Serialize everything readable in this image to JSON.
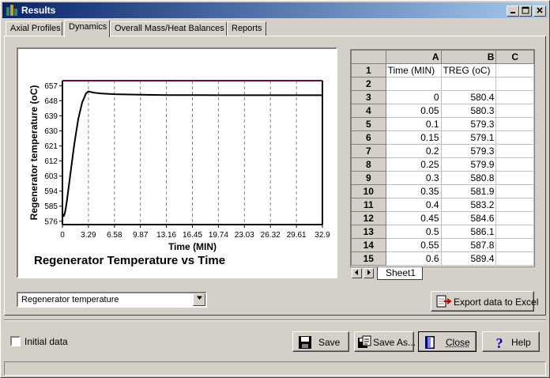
{
  "window": {
    "title": "Results"
  },
  "tabs": [
    {
      "label": "Axial Profiles"
    },
    {
      "label": "Dynamics"
    },
    {
      "label": "Overall Mass/Heat Balances"
    },
    {
      "label": "Reports"
    }
  ],
  "chart_data": {
    "type": "line",
    "title": "Regenerator Temperature vs Time",
    "xlabel": "Time (MIN)",
    "ylabel": "Regenerator temperature (oC)",
    "x_ticks": [
      "0",
      "3.29",
      "6.58",
      "9.87",
      "13.16",
      "16.45",
      "19.74",
      "23.03",
      "26.32",
      "29.61",
      "32.9"
    ],
    "y_ticks": [
      "576",
      "585",
      "594",
      "603",
      "612",
      "621",
      "630",
      "639",
      "648",
      "657"
    ],
    "xlim": [
      0,
      32.9
    ],
    "ylim": [
      574,
      660
    ],
    "grid": "vertical dashed",
    "colors": {
      "line": "#000000",
      "top_border": "#800040"
    },
    "series": [
      {
        "x": [
          0,
          0.05,
          0.1,
          0.15,
          0.2,
          0.25,
          0.3,
          0.35,
          0.4,
          0.45,
          0.5,
          0.55,
          0.6,
          1.0,
          1.5,
          2.0,
          2.5,
          3.0,
          3.3,
          3.6,
          4.0,
          5.0,
          6.58,
          9.87,
          13.16,
          16.45,
          19.74,
          23.03,
          26.32,
          29.61,
          32.9
        ],
        "y": [
          580.4,
          580.3,
          579.3,
          579.1,
          579.3,
          579.9,
          580.8,
          581.9,
          583.2,
          584.6,
          586.1,
          587.8,
          589.4,
          604,
          622,
          637,
          647,
          652.5,
          653.6,
          653.2,
          652.8,
          652.3,
          651.9,
          651.6,
          651.4,
          651.4,
          651.3,
          651.3,
          651.3,
          651.3,
          651.3
        ]
      }
    ]
  },
  "sheet": {
    "columns": [
      "A",
      "B",
      "C"
    ],
    "rows": [
      {
        "n": "1",
        "a": "Time (MIN)",
        "b": "TREG (oC)",
        "c": ""
      },
      {
        "n": "2",
        "a": "",
        "b": "",
        "c": ""
      },
      {
        "n": "3",
        "a": "0",
        "b": "580.4",
        "c": ""
      },
      {
        "n": "4",
        "a": "0.05",
        "b": "580.3",
        "c": ""
      },
      {
        "n": "5",
        "a": "0.1",
        "b": "579.3",
        "c": ""
      },
      {
        "n": "6",
        "a": "0.15",
        "b": "579.1",
        "c": ""
      },
      {
        "n": "7",
        "a": "0.2",
        "b": "579.3",
        "c": ""
      },
      {
        "n": "8",
        "a": "0.25",
        "b": "579.9",
        "c": ""
      },
      {
        "n": "9",
        "a": "0.3",
        "b": "580.8",
        "c": ""
      },
      {
        "n": "10",
        "a": "0.35",
        "b": "581.9",
        "c": ""
      },
      {
        "n": "11",
        "a": "0.4",
        "b": "583.2",
        "c": ""
      },
      {
        "n": "12",
        "a": "0.45",
        "b": "584.6",
        "c": ""
      },
      {
        "n": "13",
        "a": "0.5",
        "b": "586.1",
        "c": ""
      },
      {
        "n": "14",
        "a": "0.55",
        "b": "587.8",
        "c": ""
      },
      {
        "n": "15",
        "a": "0.6",
        "b": "589.4",
        "c": ""
      }
    ],
    "tab_label": "Sheet1"
  },
  "dropdown": {
    "value": "Regenerator temperature"
  },
  "buttons": {
    "export": "Export data to Excel",
    "save": "Save",
    "save_as": "Save As...",
    "close": "Close",
    "help": "Help"
  },
  "checkbox": {
    "label": "Initial data"
  }
}
